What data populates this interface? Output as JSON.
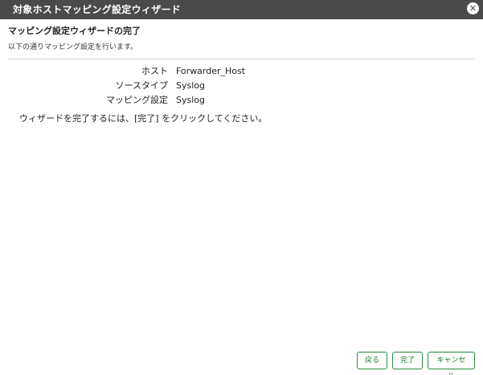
{
  "window": {
    "title": "対象ホストマッピング設定ウィザード",
    "close_icon": "close-icon"
  },
  "page": {
    "heading": "マッピング設定ウィザードの完了",
    "subheading": "以下の通りマッピング設定を行います。"
  },
  "summary": {
    "rows": [
      {
        "label": "ホスト",
        "value": "Forwarder_Host"
      },
      {
        "label": "ソースタイプ",
        "value": "Syslog"
      },
      {
        "label": "マッピング設定",
        "value": "Syslog"
      }
    ]
  },
  "instruction": "ウィザードを完了するには、[完了] をクリックしてください。",
  "buttons": {
    "back": "戻る",
    "finish": "完了",
    "cancel": "キャンセル"
  },
  "colors": {
    "titlebar": "#4a4a4a",
    "button_border": "#2a8a3a",
    "button_text": "#1f7a2e"
  }
}
